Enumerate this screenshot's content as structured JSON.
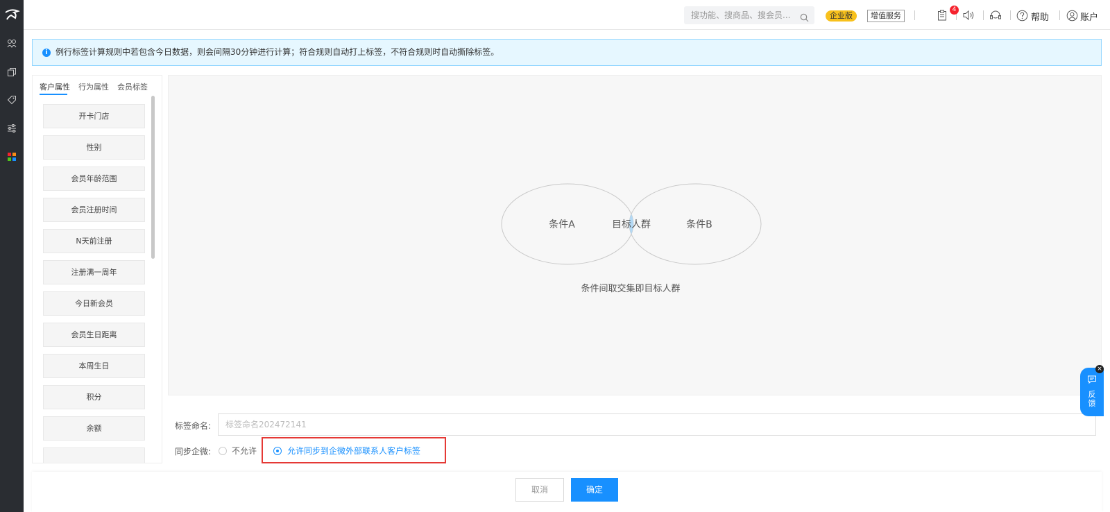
{
  "topbar": {
    "search_placeholder": "搜功能、搜商品、搜会员...",
    "edition_badge": "企业版",
    "value_added_label": "增值服务",
    "notification_count": "4",
    "help_label": "帮助",
    "account_label": "账户"
  },
  "notice": {
    "text": "例行标签计算规则中若包含今日数据，则会间隔30分钟进行计算；符合规则自动打上标签，不符合规则时自动撕除标签。"
  },
  "left_panel": {
    "tabs": [
      "客户属性",
      "行为属性",
      "会员标签"
    ],
    "items": [
      "开卡门店",
      "性别",
      "会员年龄范围",
      "会员注册时间",
      "N天前注册",
      "注册满一周年",
      "今日新会员",
      "会员生日距离",
      "本周生日",
      "积分",
      "余额"
    ]
  },
  "venn": {
    "left_label": "条件A",
    "center_label": "目标人群",
    "right_label": "条件B",
    "caption": "条件间取交集即目标人群"
  },
  "form": {
    "name_label": "标签命名:",
    "name_placeholder": "标签命名202472141",
    "sync_label": "同步企微:",
    "option_deny": "不允许",
    "option_allow": "允许同步到企微外部联系人客户标签"
  },
  "footer": {
    "cancel_label": "取消",
    "confirm_label": "确定"
  },
  "feedback": {
    "label_line1": "反",
    "label_line2": "馈",
    "close_symbol": "×"
  },
  "colors": {
    "primary": "#1890ff",
    "sidebar_bg": "#2a2d32",
    "highlight": "#e53935",
    "edition_badge": "#f8c11c"
  }
}
